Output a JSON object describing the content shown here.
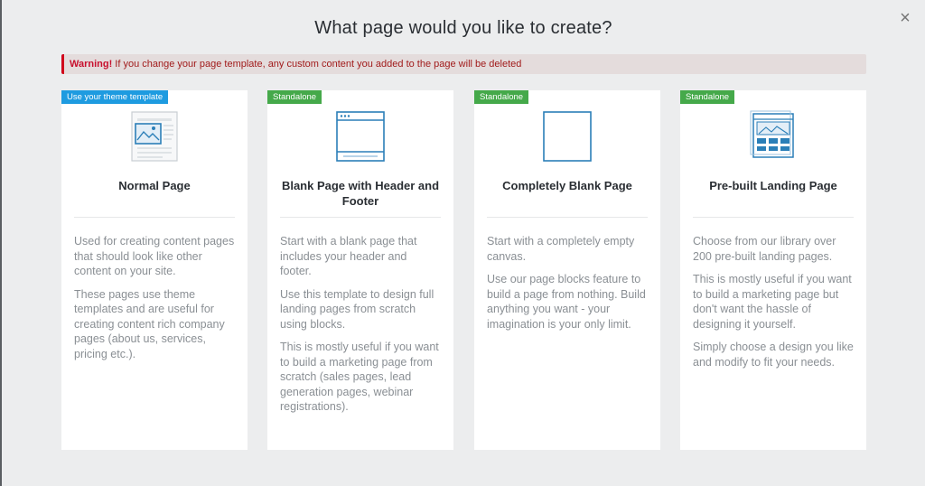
{
  "dialog": {
    "title": "What page would you like to create?",
    "close_symbol": "×"
  },
  "warning": {
    "label": "Warning!",
    "text": " If you change your page template, any custom content you added to the page will be deleted"
  },
  "cards": [
    {
      "badge": "Use your theme template",
      "title": "Normal Page",
      "icon": "theme-page-icon",
      "paragraphs": [
        "Used for creating content pages that should look like other content on your site.",
        "These pages use theme templates and are useful for creating content rich company pages (about us, services, pricing etc.)."
      ]
    },
    {
      "badge": "Standalone",
      "title": "Blank Page with Header and Footer",
      "icon": "browser-window-icon",
      "paragraphs": [
        "Start with a blank page that includes your header and footer.",
        "Use this template to design full landing pages from scratch using blocks.",
        "This is mostly useful if you want to build a marketing page from scratch (sales pages, lead generation pages, webinar registrations)."
      ]
    },
    {
      "badge": "Standalone",
      "title": "Completely Blank Page",
      "icon": "blank-square-icon",
      "paragraphs": [
        "Start with a completely empty canvas.",
        "Use our page blocks feature to build a page from nothing. Build anything you want - your imagination is your only limit."
      ]
    },
    {
      "badge": "Standalone",
      "title": "Pre-built Landing Page",
      "icon": "landing-page-icon",
      "paragraphs": [
        "Choose from our library over 200 pre-built landing pages.",
        "This is mostly useful if you want to build a marketing page but don't want the hassle of designing it yourself.",
        "Simply choose a design you like and modify to fit your needs."
      ]
    }
  ],
  "colors": {
    "theme_badge": "#1e9be0",
    "standalone_badge": "#45a94a",
    "warning_accent": "#d0021b",
    "icon_blue": "#2b7fb8"
  }
}
